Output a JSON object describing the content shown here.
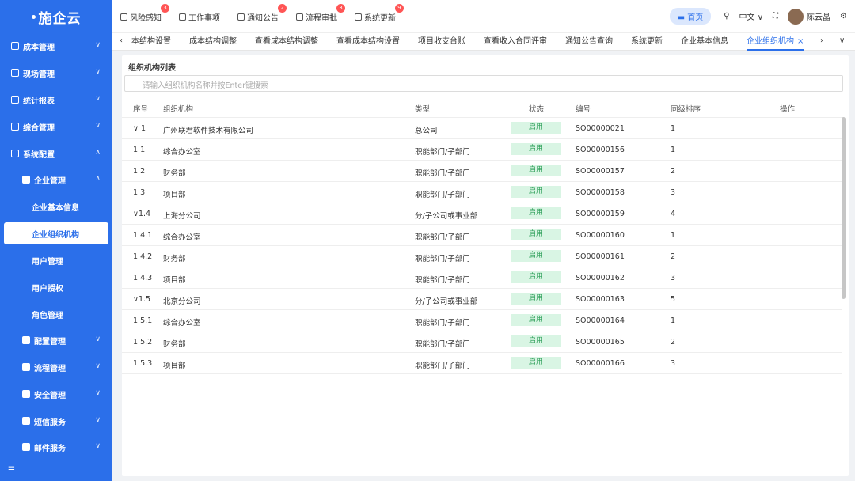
{
  "sidebar": {
    "logo": "施企云",
    "menu": [
      {
        "label": "成本管理",
        "chev": "∨"
      },
      {
        "label": "现场管理",
        "chev": "∨"
      },
      {
        "label": "统计报表",
        "chev": "∨"
      },
      {
        "label": "综合管理",
        "chev": "∨"
      },
      {
        "label": "系统配置",
        "chev": "∧"
      },
      {
        "label": "企业管理",
        "chev": "∧"
      },
      {
        "label": "企业基本信息"
      },
      {
        "label": "企业组织机构"
      },
      {
        "label": "用户管理"
      },
      {
        "label": "用户授权"
      },
      {
        "label": "角色管理"
      },
      {
        "label": "配置管理",
        "chev": "∨"
      },
      {
        "label": "流程管理",
        "chev": "∨"
      },
      {
        "label": "安全管理",
        "chev": "∨"
      },
      {
        "label": "短信服务",
        "chev": "∨"
      },
      {
        "label": "邮件服务",
        "chev": "∨"
      }
    ],
    "collapse_icon": "☰"
  },
  "header": {
    "nav": [
      {
        "label": "风险感知",
        "badge": "3"
      },
      {
        "label": "工作事项",
        "badge": ""
      },
      {
        "label": "通知公告",
        "badge": "2"
      },
      {
        "label": "流程审批",
        "badge": "3"
      },
      {
        "label": "系统更新",
        "badge": "9"
      }
    ],
    "home": "首页",
    "lang": "中文",
    "user": "陈云晶"
  },
  "tabs": {
    "items": [
      "本结构设置",
      "成本结构调整",
      "查看成本结构调整",
      "查看成本结构设置",
      "项目收支台账",
      "查看收入合同评审",
      "通知公告查询",
      "系统更新",
      "企业基本信息",
      "企业组织机构"
    ],
    "close": "×"
  },
  "content": {
    "title": "组织机构列表",
    "search_placeholder": "请输入组织机构名称并按Enter键搜索",
    "columns": {
      "no": "序号",
      "org": "组织机构",
      "type": "类型",
      "status": "状态",
      "code": "编号",
      "sort": "同级排序",
      "op": "操作"
    },
    "rows": [
      {
        "no": "∨ 1",
        "org": "广州联君软件技术有限公司",
        "type": "总公司",
        "status": "启用",
        "code": "SO00000021",
        "sort": "1"
      },
      {
        "no": "1.1",
        "org": "综合办公室",
        "type": "职能部门/子部门",
        "status": "启用",
        "code": "SO00000156",
        "sort": "1"
      },
      {
        "no": "1.2",
        "org": "财务部",
        "type": "职能部门/子部门",
        "status": "启用",
        "code": "SO00000157",
        "sort": "2"
      },
      {
        "no": "1.3",
        "org": "项目部",
        "type": "职能部门/子部门",
        "status": "启用",
        "code": "SO00000158",
        "sort": "3"
      },
      {
        "no": "∨1.4",
        "org": "上海分公司",
        "type": "分/子公司或事业部",
        "status": "启用",
        "code": "SO00000159",
        "sort": "4"
      },
      {
        "no": "1.4.1",
        "org": "综合办公室",
        "type": "职能部门/子部门",
        "status": "启用",
        "code": "SO00000160",
        "sort": "1"
      },
      {
        "no": "1.4.2",
        "org": "财务部",
        "type": "职能部门/子部门",
        "status": "启用",
        "code": "SO00000161",
        "sort": "2"
      },
      {
        "no": "1.4.3",
        "org": "项目部",
        "type": "职能部门/子部门",
        "status": "启用",
        "code": "SO00000162",
        "sort": "3"
      },
      {
        "no": "∨1.5",
        "org": "北京分公司",
        "type": "分/子公司或事业部",
        "status": "启用",
        "code": "SO00000163",
        "sort": "5"
      },
      {
        "no": "1.5.1",
        "org": "综合办公室",
        "type": "职能部门/子部门",
        "status": "启用",
        "code": "SO00000164",
        "sort": "1"
      },
      {
        "no": "1.5.2",
        "org": "财务部",
        "type": "职能部门/子部门",
        "status": "启用",
        "code": "SO00000165",
        "sort": "2"
      },
      {
        "no": "1.5.3",
        "org": "项目部",
        "type": "职能部门/子部门",
        "status": "启用",
        "code": "SO00000166",
        "sort": "3"
      }
    ]
  }
}
